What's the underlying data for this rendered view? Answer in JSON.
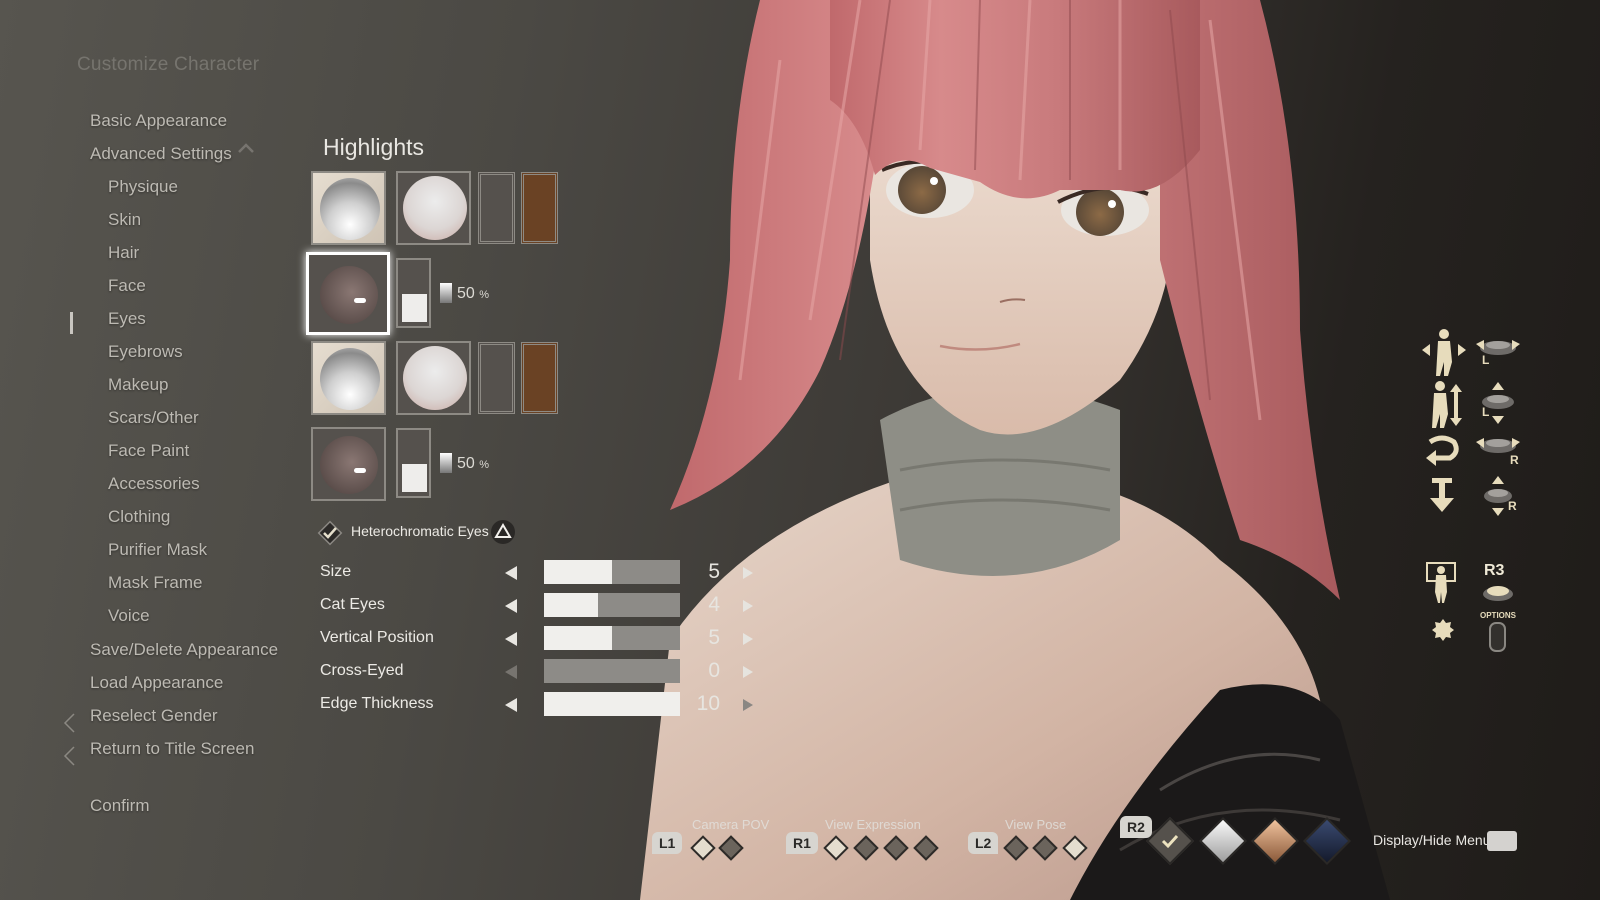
{
  "menu": {
    "title": "Customize Character",
    "items": [
      {
        "label": "Basic Appearance",
        "level": "top"
      },
      {
        "label": "Advanced Settings",
        "level": "top",
        "expanded": true
      },
      {
        "label": "Physique",
        "level": "sub"
      },
      {
        "label": "Skin",
        "level": "sub"
      },
      {
        "label": "Hair",
        "level": "sub"
      },
      {
        "label": "Face",
        "level": "sub"
      },
      {
        "label": "Eyes",
        "level": "sub",
        "selected": true
      },
      {
        "label": "Eyebrows",
        "level": "sub"
      },
      {
        "label": "Makeup",
        "level": "sub"
      },
      {
        "label": "Scars/Other",
        "level": "sub"
      },
      {
        "label": "Face Paint",
        "level": "sub"
      },
      {
        "label": "Accessories",
        "level": "sub"
      },
      {
        "label": "Clothing",
        "level": "sub"
      },
      {
        "label": "Purifier Mask",
        "level": "sub"
      },
      {
        "label": "Mask Frame",
        "level": "sub"
      },
      {
        "label": "Voice",
        "level": "sub"
      },
      {
        "label": "Save/Delete Appearance",
        "level": "top"
      },
      {
        "label": "Load Appearance",
        "level": "top"
      },
      {
        "label": "Reselect Gender",
        "level": "top",
        "back": true
      },
      {
        "label": "Return to Title Screen",
        "level": "top",
        "back": true
      },
      {
        "label": "Confirm",
        "level": "top"
      }
    ]
  },
  "highlights": {
    "title": "Highlights",
    "rows": [
      {
        "type": "color",
        "swatch_color": "#6a4224"
      },
      {
        "type": "intensity",
        "value": "50",
        "unit": "%",
        "fill_fraction": 0.5,
        "selected": true
      },
      {
        "type": "color",
        "swatch_color": "#6a4224"
      },
      {
        "type": "intensity",
        "value": "50",
        "unit": "%",
        "fill_fraction": 0.5
      }
    ],
    "heterochromatic": {
      "label": "Heterochromatic Eyes",
      "checked": true,
      "button": "triangle"
    }
  },
  "sliders": [
    {
      "label": "Size",
      "value": "5",
      "min": 0,
      "max": 10
    },
    {
      "label": "Cat Eyes",
      "value": "4",
      "min": 0,
      "max": 10
    },
    {
      "label": "Vertical Position",
      "value": "5",
      "min": 0,
      "max": 10
    },
    {
      "label": "Cross-Eyed",
      "value": "0",
      "min": 0,
      "max": 10
    },
    {
      "label": "Edge Thickness",
      "value": "10",
      "min": 0,
      "max": 10
    }
  ],
  "bottom_controls": {
    "camera_pov": {
      "button": "L1",
      "label": "Camera POV",
      "steps": 2,
      "active": 0
    },
    "view_expression": {
      "button": "R1",
      "label": "View Expression",
      "steps": 4,
      "active": 0
    },
    "view_pose": {
      "button": "L2",
      "label": "View Pose",
      "steps": 3,
      "active": 2
    },
    "lighting": {
      "button": "R2",
      "options": [
        "check",
        "silver",
        "bronze",
        "navy"
      ],
      "colors": [
        "#55514c",
        "#d8d8d8",
        "#c08a62",
        "#1f2840"
      ]
    },
    "display_hide_label": "Display/Hide Menu"
  },
  "right_controls": {
    "rows": [
      {
        "icon": "move-horizontal-icon",
        "stick": "L"
      },
      {
        "icon": "move-vertical-icon",
        "stick": "L"
      },
      {
        "icon": "rotate-icon",
        "stick": "R"
      },
      {
        "icon": "zoom-icon",
        "stick": "R"
      }
    ],
    "r3_label": "R3",
    "options_label": "OPTIONS"
  }
}
